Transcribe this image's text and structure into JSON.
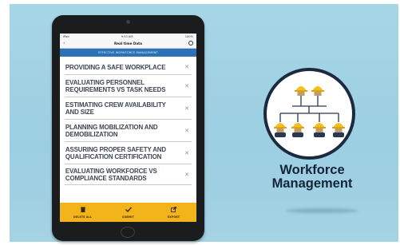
{
  "statusbar": {
    "left": "iPad",
    "time": "9:53 AM",
    "right": "100%"
  },
  "nav": {
    "title": "Real time Data"
  },
  "section": {
    "title": "EFFECTIVE WORKFORCE MANAGEMENT"
  },
  "items": [
    {
      "label": "PROVIDING A SAFE WORKPLACE"
    },
    {
      "label": "EVALUATING PERSONNEL REQUIREMENTS VS TASK NEEDS"
    },
    {
      "label": "ESTIMATING CREW AVAILABILITY AND SIZE"
    },
    {
      "label": "PLANNING MOBILIZATION AND DEMOBILIZATION"
    },
    {
      "label": "ASSURING PROPER SAFETY AND QUALIFICATION CERTIFICATION"
    },
    {
      "label": "EVALUATING WORKFORCE VS COMPLIANCE STANDARDS"
    }
  ],
  "toolbar": {
    "delete_label": "DELETE ALL",
    "submit_label": "SUBMIT",
    "export_label": "EXPORT"
  },
  "brand": {
    "line1": "Workforce",
    "line2": "Management"
  },
  "colors": {
    "background": "#a7d6e6",
    "section_bar": "#2b72b9",
    "toolbar": "#f2b31b",
    "brand_text": "#14243a",
    "hard_hat": "#f2c21b"
  },
  "icons": [
    "trash-icon",
    "checkmark-icon",
    "export-icon",
    "settings-icon",
    "back-arrow-icon",
    "remove-x-icon",
    "org-chart-icon"
  ]
}
